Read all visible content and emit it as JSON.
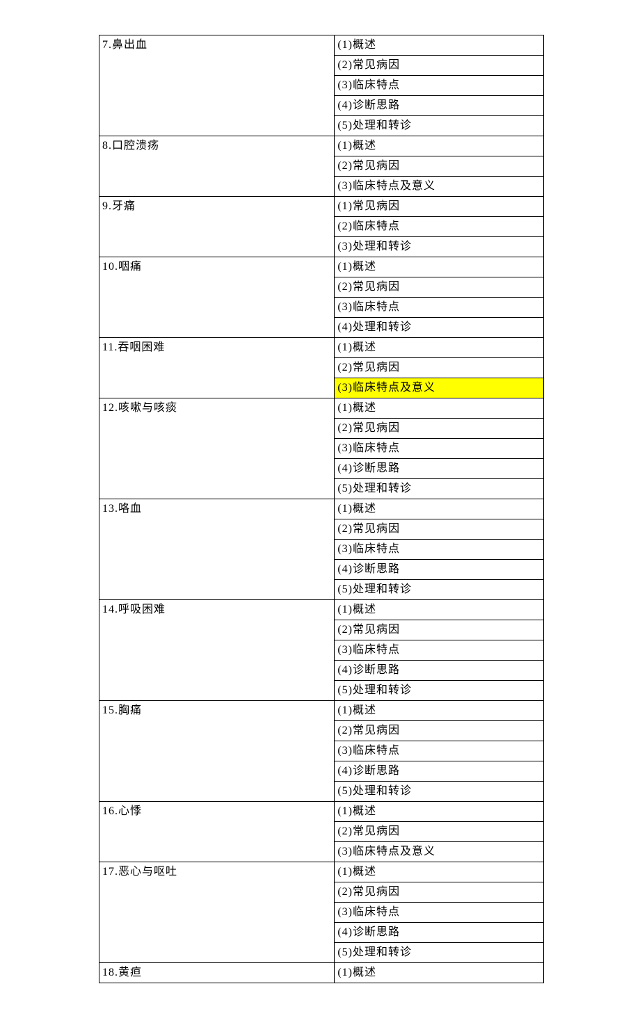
{
  "topics": [
    {
      "title": "7.鼻出血",
      "subs": [
        "(1)概述",
        "(2)常见病因",
        "(3)临床特点",
        "(4)诊断思路",
        "(5)处理和转诊"
      ]
    },
    {
      "title": "8.口腔溃疡",
      "subs": [
        "(1)概述",
        "(2)常见病因",
        "(3)临床特点及意义"
      ]
    },
    {
      "title": "9.牙痛",
      "subs": [
        "(1)常见病因",
        "(2)临床特点",
        "(3)处理和转诊"
      ]
    },
    {
      "title": "10.咽痛",
      "subs": [
        "(1)概述",
        "(2)常见病因",
        "(3)临床特点",
        "(4)处理和转诊"
      ]
    },
    {
      "title": "11.吞咽困难",
      "subs": [
        "(1)概述",
        "(2)常见病因",
        "(3)临床特点及意义"
      ],
      "highlight": [
        2
      ]
    },
    {
      "title": "12.咳嗽与咳痰",
      "subs": [
        "(1)概述",
        "(2)常见病因",
        "(3)临床特点",
        "(4)诊断思路",
        "(5)处理和转诊"
      ]
    },
    {
      "title": "13.咯血",
      "subs": [
        "(1)概述",
        "(2)常见病因",
        "(3)临床特点",
        "(4)诊断思路",
        "(5)处理和转诊"
      ]
    },
    {
      "title": "14.呼吸困难",
      "subs": [
        "(1)概述",
        "(2)常见病因",
        "(3)临床特点",
        "(4)诊断思路",
        "(5)处理和转诊"
      ]
    },
    {
      "title": "15.胸痛",
      "subs": [
        "(1)概述",
        "(2)常见病因",
        "(3)临床特点",
        "(4)诊断思路",
        "(5)处理和转诊"
      ]
    },
    {
      "title": "16.心悸",
      "subs": [
        "(1)概述",
        "(2)常见病因",
        "(3)临床特点及意义"
      ]
    },
    {
      "title": "17.恶心与呕吐",
      "subs": [
        "(1)概述",
        "(2)常见病因",
        "(3)临床特点",
        "(4)诊断思路",
        "(5)处理和转诊"
      ]
    },
    {
      "title": "18.黄疸",
      "subs": [
        "(1)概述"
      ]
    }
  ]
}
